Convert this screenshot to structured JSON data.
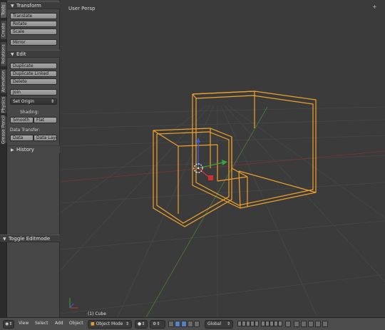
{
  "vertical_tabs": [
    "Tools",
    "Create",
    "Relations",
    "Animation",
    "Physics",
    "Grease Pencil"
  ],
  "transform_panel": {
    "title": "Transform",
    "buttons": [
      "Translate",
      "Rotate",
      "Scale",
      "Mirror"
    ]
  },
  "edit_panel": {
    "title": "Edit",
    "buttons": [
      "Duplicate",
      "Duplicate Linked",
      "Delete",
      "Join"
    ],
    "set_origin": "Set Origin",
    "shading_label": "Shading:",
    "shading_buttons": [
      "Smooth",
      "Flat"
    ],
    "data_transfer_label": "Data Transfer:",
    "data_transfer_buttons": [
      "Data",
      "Data Layo"
    ]
  },
  "history_panel": {
    "title": "History"
  },
  "toggle_editmode": "Toggle Editmode",
  "viewport": {
    "title": "User Persp",
    "object_label": "(1) Cube"
  },
  "header": {
    "menus": [
      "View",
      "Select",
      "Add",
      "Object"
    ],
    "mode": "Object Mode",
    "orientation": "Global"
  },
  "colors": {
    "selection_wire": "#f0a22a",
    "grid": "#4a4a4a",
    "axis_x": "#b03b3b",
    "axis_y": "#6aa64a"
  }
}
